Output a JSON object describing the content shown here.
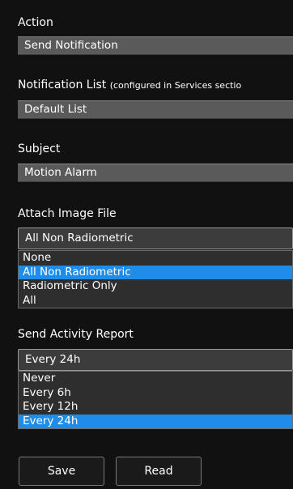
{
  "action": {
    "label": "Action",
    "value": "Send Notification"
  },
  "notification_list": {
    "label": "Notification List",
    "note": "(configured in Services sectio",
    "value": "Default List"
  },
  "subject": {
    "label": "Subject",
    "value": "Motion Alarm"
  },
  "attach_image": {
    "label": "Attach Image File",
    "selected": "All Non Radiometric",
    "options": [
      "None",
      "All Non Radiometric",
      "Radiometric Only",
      "All"
    ],
    "selected_index": 1
  },
  "activity_report": {
    "label": "Send Activity Report",
    "selected": "Every 24h",
    "options": [
      "Never",
      "Every 6h",
      "Every 12h",
      "Every 24h"
    ],
    "selected_index": 3
  },
  "buttons": {
    "save": "Save",
    "read": "Read"
  },
  "colors": {
    "background": "#111111",
    "field": "#5a5a5a",
    "selected_option": "#1e8ce8"
  }
}
